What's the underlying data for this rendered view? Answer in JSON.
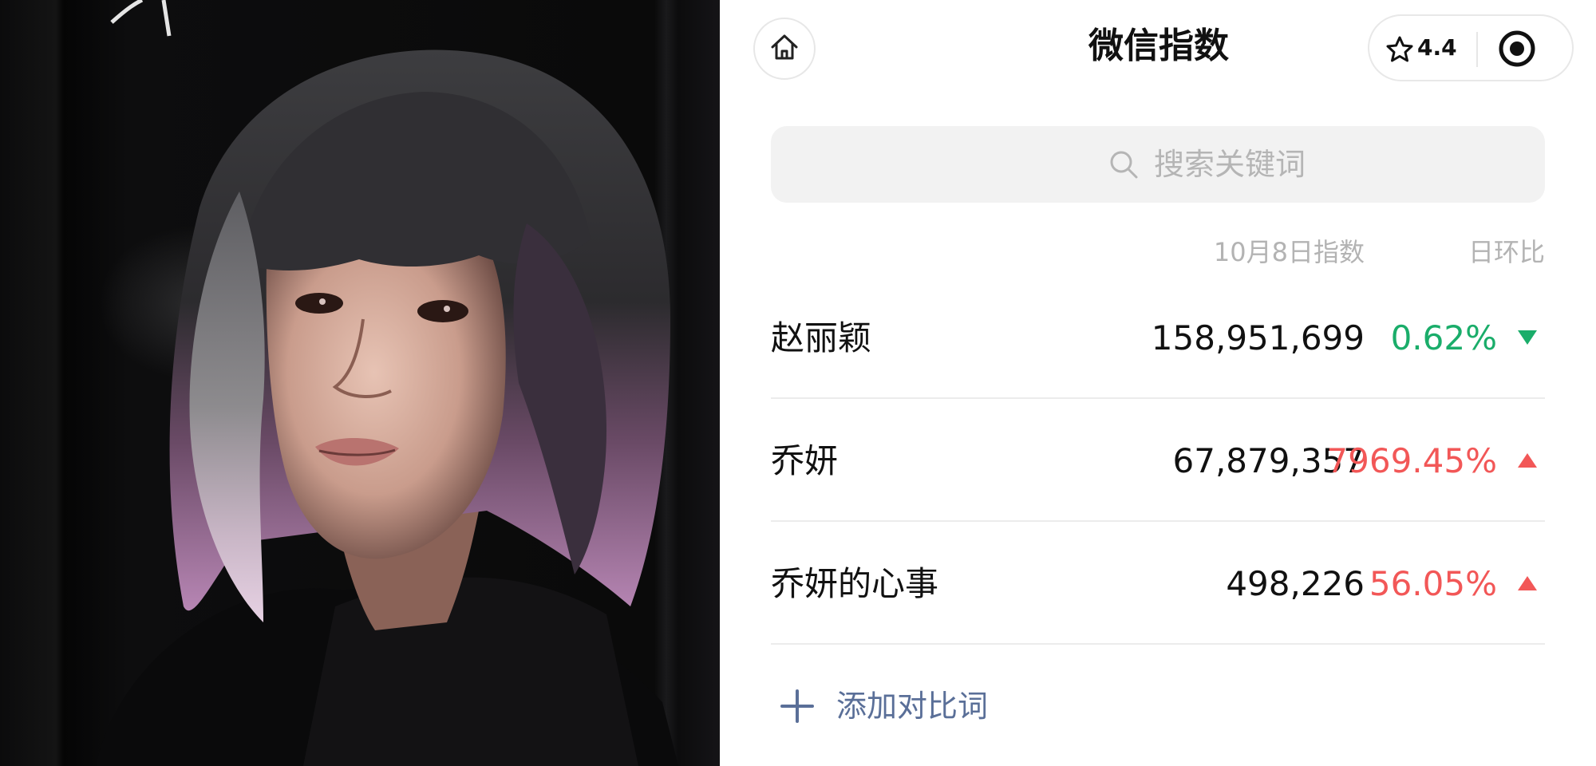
{
  "header": {
    "title": "微信指数",
    "home_icon": "home-icon",
    "rating": "4.4",
    "rating_icon": "star-outline-icon",
    "target_icon": "target-icon"
  },
  "search": {
    "placeholder": "搜索关键词",
    "icon": "search-icon"
  },
  "table": {
    "columns": [
      "10月8日指数",
      "日环比"
    ],
    "rows": [
      {
        "keyword": "赵丽颖",
        "index": "158,951,699",
        "change": "0.62%",
        "direction": "down",
        "color": "#1aad6a"
      },
      {
        "keyword": "乔妍",
        "index": "67,879,357",
        "change": "7969.45%",
        "direction": "up",
        "color": "#f25757"
      },
      {
        "keyword": "乔妍的心事",
        "index": "498,226",
        "change": "56.05%",
        "direction": "up",
        "color": "#f25757"
      }
    ]
  },
  "add_compare": {
    "label": "添加对比词",
    "icon": "plus-icon",
    "color": "#5a6f98"
  },
  "photo": {
    "description_icon": "portrait-photo"
  }
}
